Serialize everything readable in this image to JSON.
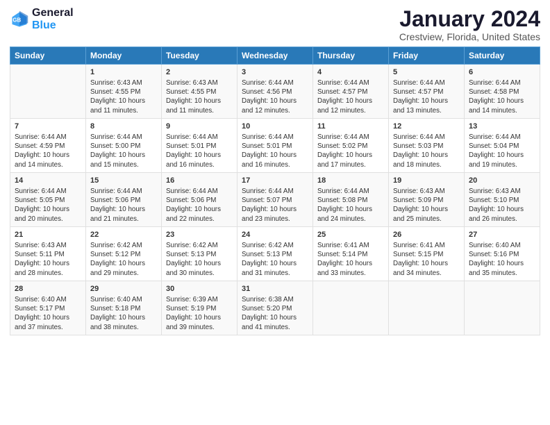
{
  "logo": {
    "line1": "General",
    "line2": "Blue"
  },
  "title": "January 2024",
  "subtitle": "Crestview, Florida, United States",
  "days_header": [
    "Sunday",
    "Monday",
    "Tuesday",
    "Wednesday",
    "Thursday",
    "Friday",
    "Saturday"
  ],
  "weeks": [
    [
      {
        "num": "",
        "info": ""
      },
      {
        "num": "1",
        "info": "Sunrise: 6:43 AM\nSunset: 4:55 PM\nDaylight: 10 hours\nand 11 minutes."
      },
      {
        "num": "2",
        "info": "Sunrise: 6:43 AM\nSunset: 4:55 PM\nDaylight: 10 hours\nand 11 minutes."
      },
      {
        "num": "3",
        "info": "Sunrise: 6:44 AM\nSunset: 4:56 PM\nDaylight: 10 hours\nand 12 minutes."
      },
      {
        "num": "4",
        "info": "Sunrise: 6:44 AM\nSunset: 4:57 PM\nDaylight: 10 hours\nand 12 minutes."
      },
      {
        "num": "5",
        "info": "Sunrise: 6:44 AM\nSunset: 4:57 PM\nDaylight: 10 hours\nand 13 minutes."
      },
      {
        "num": "6",
        "info": "Sunrise: 6:44 AM\nSunset: 4:58 PM\nDaylight: 10 hours\nand 14 minutes."
      }
    ],
    [
      {
        "num": "7",
        "info": "Sunrise: 6:44 AM\nSunset: 4:59 PM\nDaylight: 10 hours\nand 14 minutes."
      },
      {
        "num": "8",
        "info": "Sunrise: 6:44 AM\nSunset: 5:00 PM\nDaylight: 10 hours\nand 15 minutes."
      },
      {
        "num": "9",
        "info": "Sunrise: 6:44 AM\nSunset: 5:01 PM\nDaylight: 10 hours\nand 16 minutes."
      },
      {
        "num": "10",
        "info": "Sunrise: 6:44 AM\nSunset: 5:01 PM\nDaylight: 10 hours\nand 16 minutes."
      },
      {
        "num": "11",
        "info": "Sunrise: 6:44 AM\nSunset: 5:02 PM\nDaylight: 10 hours\nand 17 minutes."
      },
      {
        "num": "12",
        "info": "Sunrise: 6:44 AM\nSunset: 5:03 PM\nDaylight: 10 hours\nand 18 minutes."
      },
      {
        "num": "13",
        "info": "Sunrise: 6:44 AM\nSunset: 5:04 PM\nDaylight: 10 hours\nand 19 minutes."
      }
    ],
    [
      {
        "num": "14",
        "info": "Sunrise: 6:44 AM\nSunset: 5:05 PM\nDaylight: 10 hours\nand 20 minutes."
      },
      {
        "num": "15",
        "info": "Sunrise: 6:44 AM\nSunset: 5:06 PM\nDaylight: 10 hours\nand 21 minutes."
      },
      {
        "num": "16",
        "info": "Sunrise: 6:44 AM\nSunset: 5:06 PM\nDaylight: 10 hours\nand 22 minutes."
      },
      {
        "num": "17",
        "info": "Sunrise: 6:44 AM\nSunset: 5:07 PM\nDaylight: 10 hours\nand 23 minutes."
      },
      {
        "num": "18",
        "info": "Sunrise: 6:44 AM\nSunset: 5:08 PM\nDaylight: 10 hours\nand 24 minutes."
      },
      {
        "num": "19",
        "info": "Sunrise: 6:43 AM\nSunset: 5:09 PM\nDaylight: 10 hours\nand 25 minutes."
      },
      {
        "num": "20",
        "info": "Sunrise: 6:43 AM\nSunset: 5:10 PM\nDaylight: 10 hours\nand 26 minutes."
      }
    ],
    [
      {
        "num": "21",
        "info": "Sunrise: 6:43 AM\nSunset: 5:11 PM\nDaylight: 10 hours\nand 28 minutes."
      },
      {
        "num": "22",
        "info": "Sunrise: 6:42 AM\nSunset: 5:12 PM\nDaylight: 10 hours\nand 29 minutes."
      },
      {
        "num": "23",
        "info": "Sunrise: 6:42 AM\nSunset: 5:13 PM\nDaylight: 10 hours\nand 30 minutes."
      },
      {
        "num": "24",
        "info": "Sunrise: 6:42 AM\nSunset: 5:13 PM\nDaylight: 10 hours\nand 31 minutes."
      },
      {
        "num": "25",
        "info": "Sunrise: 6:41 AM\nSunset: 5:14 PM\nDaylight: 10 hours\nand 33 minutes."
      },
      {
        "num": "26",
        "info": "Sunrise: 6:41 AM\nSunset: 5:15 PM\nDaylight: 10 hours\nand 34 minutes."
      },
      {
        "num": "27",
        "info": "Sunrise: 6:40 AM\nSunset: 5:16 PM\nDaylight: 10 hours\nand 35 minutes."
      }
    ],
    [
      {
        "num": "28",
        "info": "Sunrise: 6:40 AM\nSunset: 5:17 PM\nDaylight: 10 hours\nand 37 minutes."
      },
      {
        "num": "29",
        "info": "Sunrise: 6:40 AM\nSunset: 5:18 PM\nDaylight: 10 hours\nand 38 minutes."
      },
      {
        "num": "30",
        "info": "Sunrise: 6:39 AM\nSunset: 5:19 PM\nDaylight: 10 hours\nand 39 minutes."
      },
      {
        "num": "31",
        "info": "Sunrise: 6:38 AM\nSunset: 5:20 PM\nDaylight: 10 hours\nand 41 minutes."
      },
      {
        "num": "",
        "info": ""
      },
      {
        "num": "",
        "info": ""
      },
      {
        "num": "",
        "info": ""
      }
    ]
  ]
}
